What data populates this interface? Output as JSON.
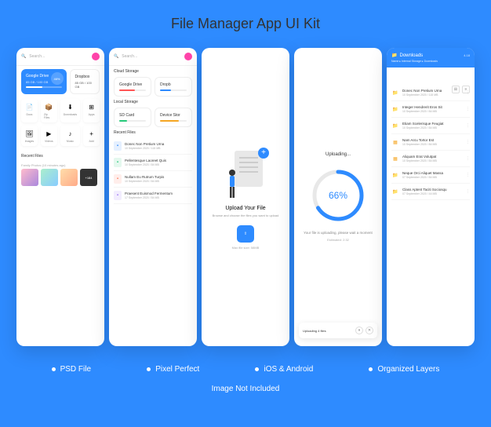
{
  "title": "File Manager App UI Kit",
  "search_placeholder": "Search...",
  "screen1": {
    "drive": {
      "title": "Google Drive",
      "sub": "85 GB / 100 GB",
      "percent": "46%"
    },
    "dropbox": {
      "title": "Dropbox",
      "sub": "85 GB / 100 GB"
    },
    "categories": [
      {
        "icon": "📄",
        "label": "Docs"
      },
      {
        "icon": "📦",
        "label": "Zip Files"
      },
      {
        "icon": "⬇",
        "label": "Downloads"
      },
      {
        "icon": "⊞",
        "label": "Apps"
      },
      {
        "icon": "🖼",
        "label": "Images"
      },
      {
        "icon": "▶",
        "label": "Videos"
      },
      {
        "icon": "♪",
        "label": "Music"
      },
      {
        "icon": "+",
        "label": "Add"
      }
    ],
    "section": "Recent Files",
    "subtime": "Family Photos (10 minutes ago)",
    "more": "+184"
  },
  "screen2": {
    "cloud_title": "Cloud Storage",
    "local_title": "Local Storage",
    "drive": {
      "title": "Google Drive"
    },
    "dropbox": {
      "title": "Dropb"
    },
    "sd": {
      "title": "SD Card"
    },
    "device": {
      "title": "Device Stor"
    },
    "section": "Recent Files",
    "files": [
      {
        "name": "Donec Non Pretium Urna",
        "meta": "10 September 2020 / 115 MB",
        "color": "#2e8bff"
      },
      {
        "name": "Pellentesque Laoreet Quis",
        "meta": "10 September 2020 / 84 MB",
        "color": "#27c97a"
      },
      {
        "name": "Nullam Eu Rutrum Turpis",
        "meta": "10 September 2020 / 84 MB",
        "color": "#ff7a5c"
      },
      {
        "name": "Praesent Euismod Fermentum",
        "meta": "17 September 2020 / 84 MB",
        "color": "#9b6ff5"
      }
    ]
  },
  "screen3": {
    "title": "Upload Your File",
    "sub": "Browse and choose the files you want to upload",
    "note": "Max file size: 58MB"
  },
  "screen4": {
    "title": "Uploading...",
    "percent": "66%",
    "status": "Your file is uploading, please wait a moment",
    "estimated": "Estimated: 2:32",
    "bar_text": "Uploading 4 files"
  },
  "screen5": {
    "title": "Downloads",
    "count": "4.18",
    "breadcrumb": "Name ▸ Internal Storage ▸ Downloads",
    "files": [
      {
        "name": "Donec Non Pretium Urna",
        "meta": "10 September 2020 / 115 MB",
        "icon": "📁"
      },
      {
        "name": "Integer Hendrerit Eros Sit",
        "meta": "10 September 2020 / 84 MB",
        "icon": "📁"
      },
      {
        "name": "Etiam Scelerisque Feugiat",
        "meta": "10 September 2020 / 84 MB",
        "icon": "📁"
      },
      {
        "name": "Nam Arcu Tortor Est",
        "meta": "10 September 2020 / 84 MB",
        "icon": "▦"
      },
      {
        "name": "Aliquam Erat Volutpat",
        "meta": "10 September 2020 / 84 MB",
        "icon": "▦"
      },
      {
        "name": "Neque Orci Aliquet Massa",
        "meta": "07 September 2020 / 84 MB",
        "icon": "📁"
      },
      {
        "name": "Class Aptent Taciti Sociosqu",
        "meta": "07 September 2020 / 44 MB",
        "icon": "📁"
      }
    ]
  },
  "footer": [
    "PSD File",
    "Pixel Perfect",
    "iOS & Android",
    "Organized Layers"
  ],
  "disclaimer": "Image Not Included"
}
